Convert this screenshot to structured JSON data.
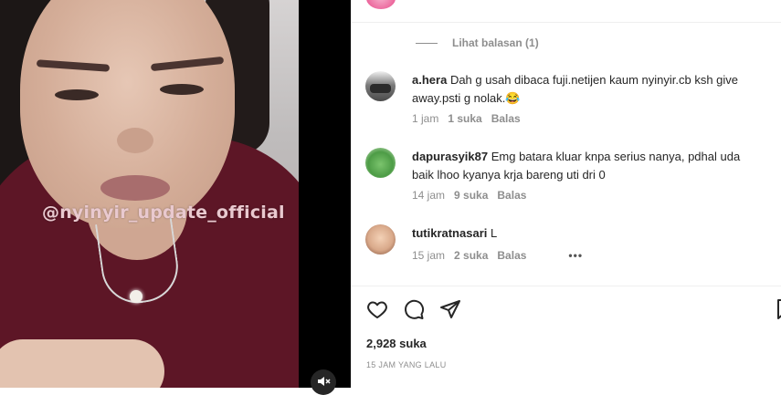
{
  "media": {
    "watermark": "@nyinyir_update_official",
    "mute_icon": "speaker-muted-icon"
  },
  "view_replies": "Lihat balasan (1)",
  "comments": [
    {
      "username": "a.hera",
      "text": "Dah g usah dibaca fuji.netijen kaum nyinyir.cb ksh give away.psti g nolak.😂",
      "time": "1 jam",
      "likes": "1 suka",
      "reply": "Balas"
    },
    {
      "username": "dapurasyik87",
      "text": "Emg batara kluar knpa serius nanya, pdhal uda baik lhoo kyanya krja bareng uti dri 0",
      "time": "14 jam",
      "likes": "9 suka",
      "reply": "Balas"
    },
    {
      "username": "tutikratnasari",
      "text": "L",
      "time": "15 jam",
      "likes": "2 suka",
      "reply": "Balas",
      "more": "•••"
    }
  ],
  "actions": {
    "like_icon": "heart-icon",
    "comment_icon": "comment-icon",
    "share_icon": "paper-plane-icon",
    "save_icon": "bookmark-icon"
  },
  "post": {
    "likes": "2,928 suka",
    "time_ago": "15 JAM YANG LALU"
  }
}
